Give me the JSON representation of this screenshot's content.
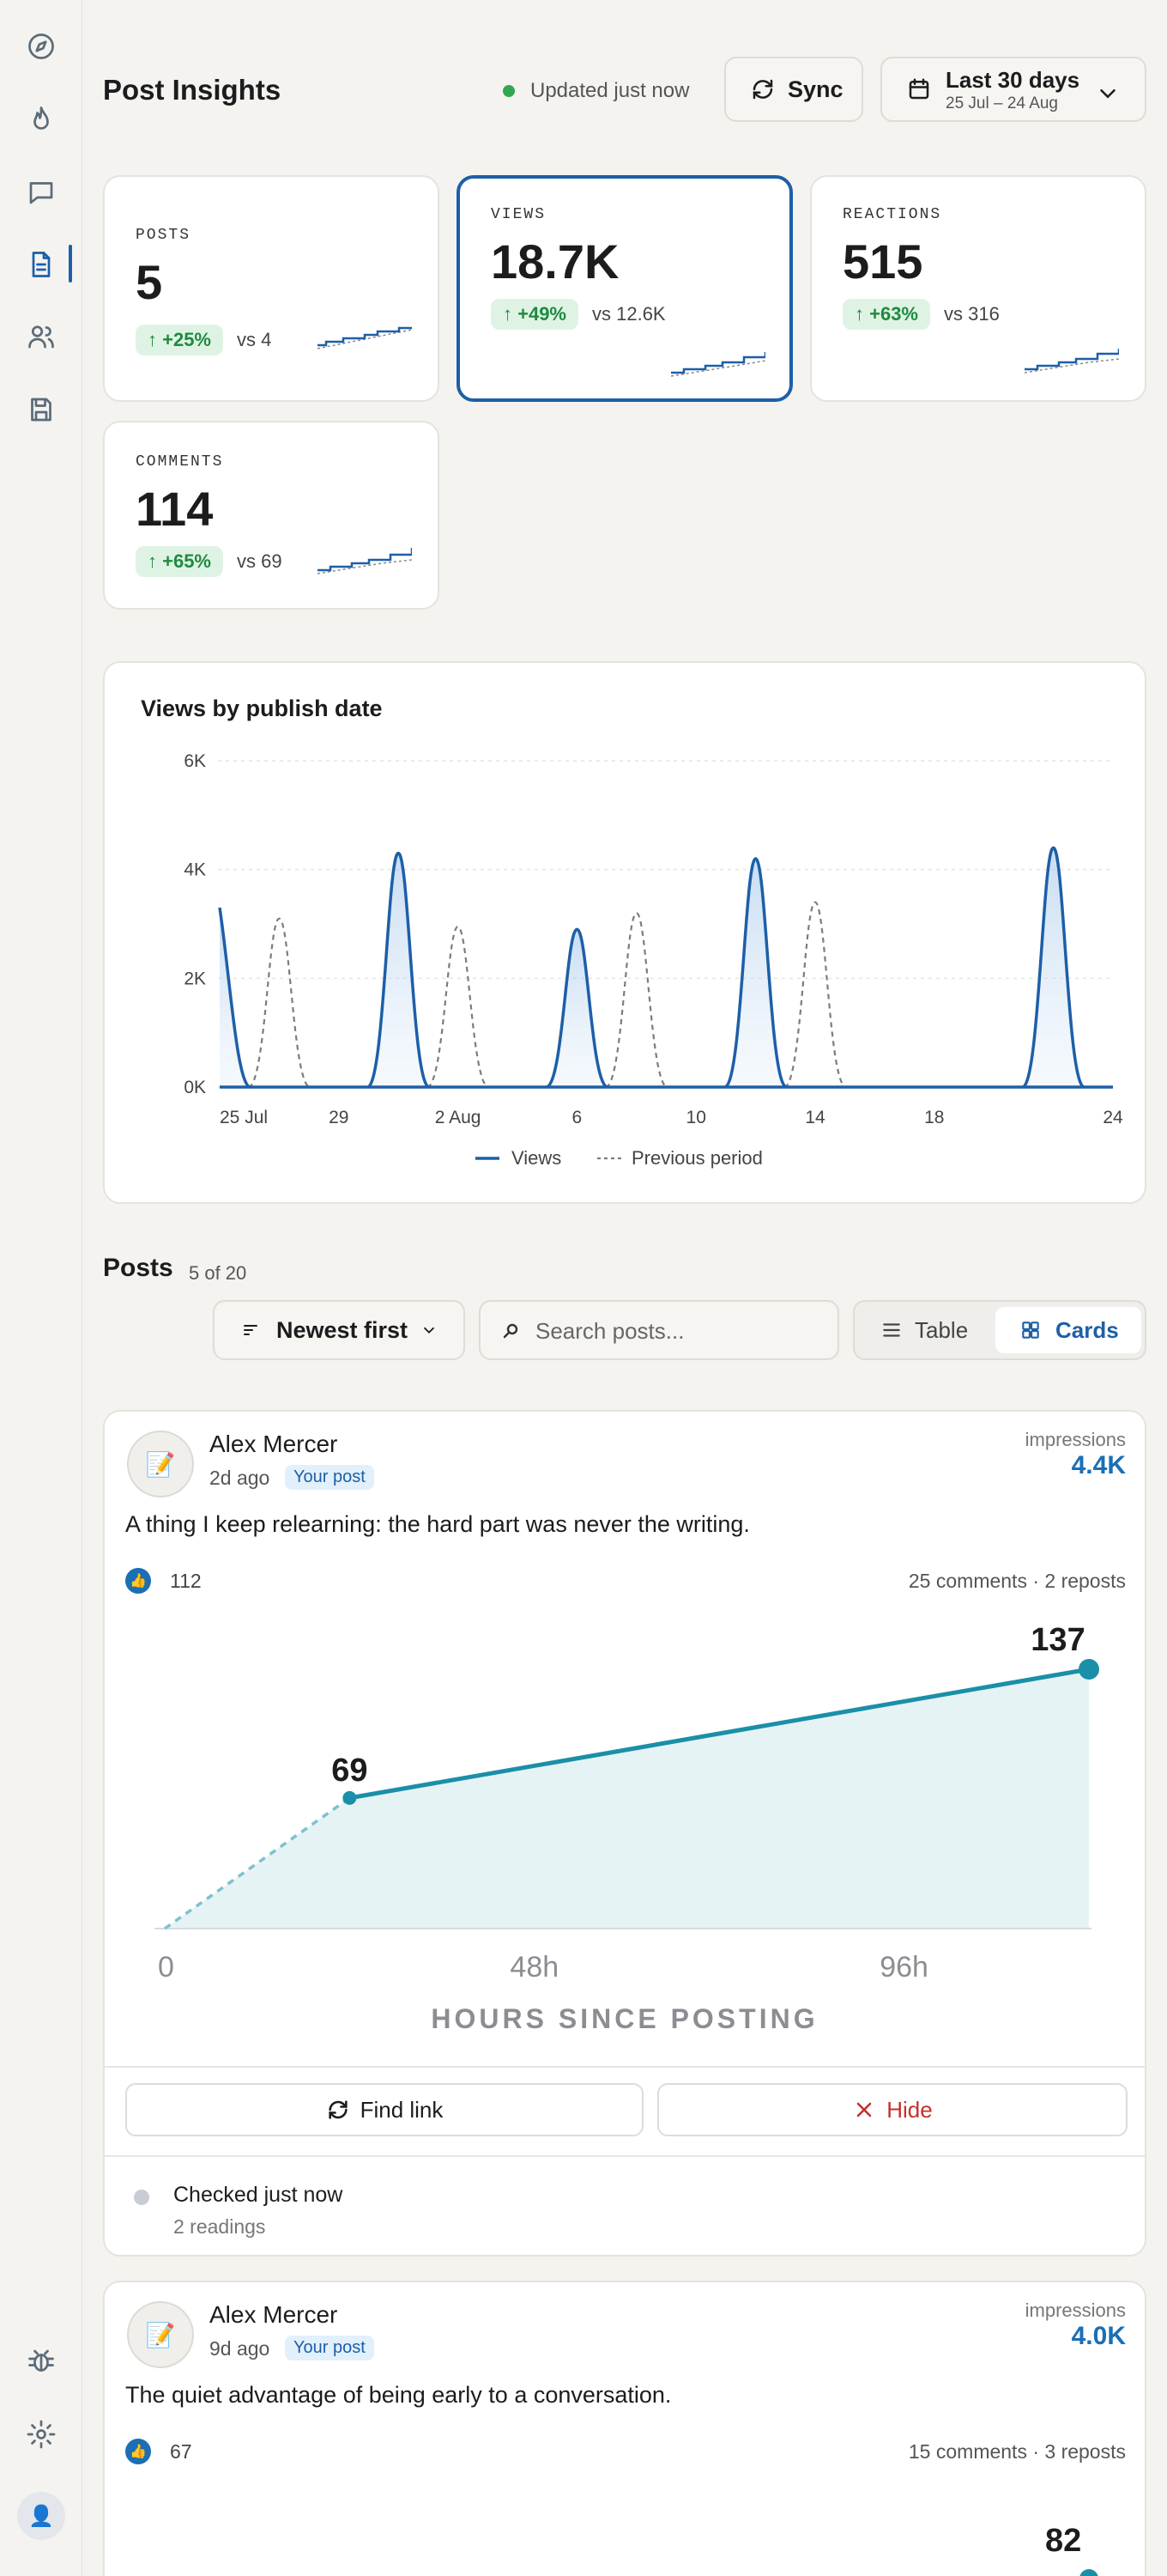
{
  "header": {
    "title": "Post Insights",
    "updated": "Updated just now",
    "sync_label": "Sync",
    "date_range_label": "Last 30 days",
    "date_range_sub": "25 Jul – 24 Aug"
  },
  "metrics": [
    {
      "label": "POSTS",
      "value": "5",
      "delta": "↑ +25%",
      "vs": "vs 4"
    },
    {
      "label": "VIEWS",
      "value": "18.7K",
      "delta": "↑ +49%",
      "vs": "vs 12.6K"
    },
    {
      "label": "REACTIONS",
      "value": "515",
      "delta": "↑ +63%",
      "vs": "vs 316"
    },
    {
      "label": "COMMENTS",
      "value": "114",
      "delta": "↑ +65%",
      "vs": "vs 69"
    }
  ],
  "colors": {
    "accent": "#1d5fa8",
    "positive": "#1d8b3e",
    "danger": "#c4302b",
    "post_line": "#1b8fa8"
  },
  "chart_data": [
    {
      "type": "area",
      "title": "Views by publish date",
      "x_tick_labels": [
        "25 Jul",
        "29",
        "2 Aug",
        "6",
        "10",
        "14",
        "18",
        "24"
      ],
      "y_tick_labels": [
        "0K",
        "2K",
        "4K",
        "6K"
      ],
      "ylim": [
        0,
        6000
      ],
      "grid": true,
      "legend_position": "bottom",
      "series": [
        {
          "name": "Views",
          "style": "solid",
          "points": [
            {
              "x": "25 Jul",
              "y": 3300
            },
            {
              "x": "31 Jul",
              "y": 4300
            },
            {
              "x": "6 Aug",
              "y": 2900
            },
            {
              "x": "12 Aug",
              "y": 4200
            },
            {
              "x": "22 Aug",
              "y": 4400
            }
          ]
        },
        {
          "name": "Previous period",
          "style": "dashed",
          "points": [
            {
              "x": "27 Jul",
              "y": 3100
            },
            {
              "x": "2 Aug",
              "y": 2950
            },
            {
              "x": "8 Aug",
              "y": 3200
            },
            {
              "x": "14 Aug",
              "y": 3400
            }
          ]
        }
      ]
    },
    {
      "type": "line",
      "xlabel": "HOURS SINCE POSTING",
      "x_tick_labels": [
        "0",
        "48h",
        "96h"
      ],
      "points": [
        {
          "x": 0,
          "y": 0
        },
        {
          "x": 24,
          "y": 69
        },
        {
          "x": 120,
          "y": 137
        }
      ],
      "point_labels": [
        "69",
        "137"
      ]
    }
  ],
  "posts_section": {
    "title": "Posts",
    "count": "5 of 20",
    "sort_label": "Newest first",
    "search_placeholder": "Search posts...",
    "view_table": "Table",
    "view_cards": "Cards"
  },
  "posts": [
    {
      "author": "Alex Mercer",
      "time": "2d ago",
      "badge": "Your post",
      "impressions_label": "impressions",
      "impressions": "4.4K",
      "text": "A thing I keep relearning: the hard part was never the writing.",
      "likes": "112",
      "meta": "25 comments · 2 reposts",
      "find_label": "Find link",
      "hide_label": "Hide",
      "status": "Checked just now",
      "status_sub": "2 readings"
    },
    {
      "author": "Alex Mercer",
      "time": "9d ago",
      "badge": "Your post",
      "impressions_label": "impressions",
      "impressions": "4.0K",
      "text": "The quiet advantage of being early to a conversation.",
      "likes": "67",
      "meta": "15 comments · 3 reposts",
      "peak_label": "82"
    }
  ]
}
